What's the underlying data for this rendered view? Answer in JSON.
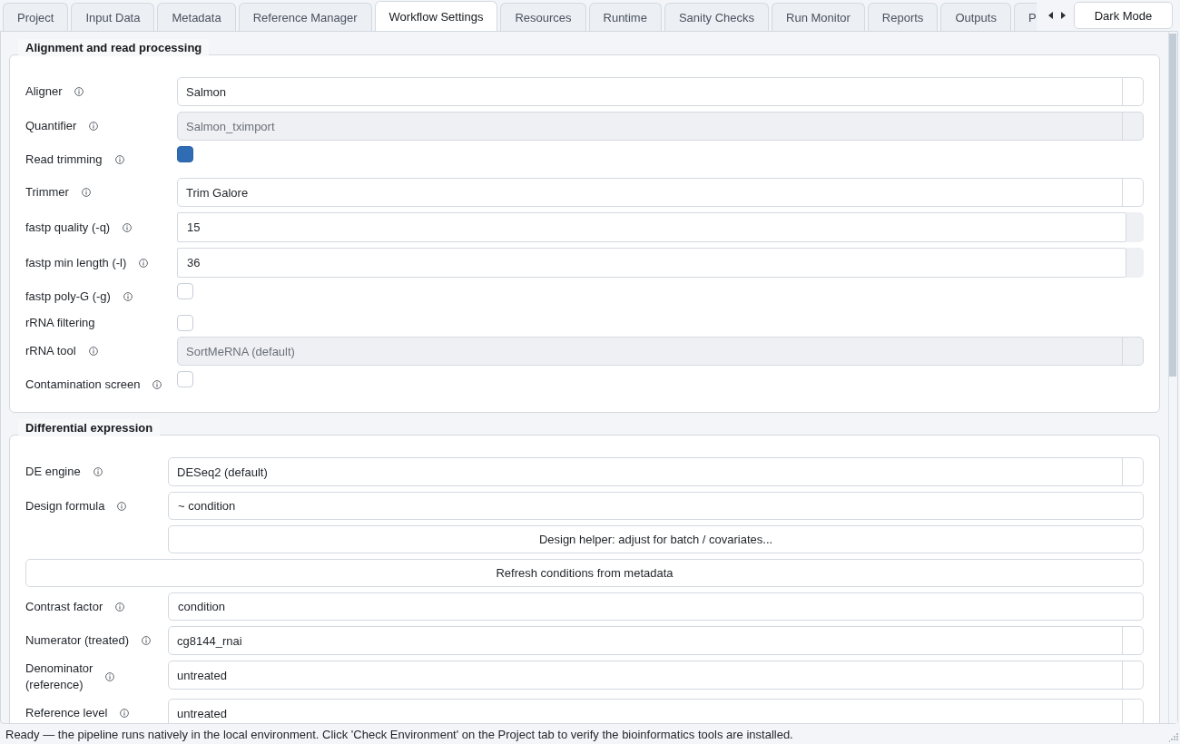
{
  "tabs": [
    {
      "label": "Project",
      "selected": false
    },
    {
      "label": "Input Data",
      "selected": false
    },
    {
      "label": "Metadata",
      "selected": false
    },
    {
      "label": "Reference Manager",
      "selected": false
    },
    {
      "label": "Workflow Settings",
      "selected": true
    },
    {
      "label": "Resources",
      "selected": false
    },
    {
      "label": "Runtime",
      "selected": false
    },
    {
      "label": "Sanity Checks",
      "selected": false
    },
    {
      "label": "Run Monitor",
      "selected": false
    },
    {
      "label": "Reports",
      "selected": false
    },
    {
      "label": "Outputs",
      "selected": false
    },
    {
      "label": "P",
      "selected": false
    }
  ],
  "dark_mode_button": {
    "label": "Dark Mode"
  },
  "groups": [
    {
      "title": "Alignment and read processing",
      "rows": [
        {
          "kind": "combo",
          "label": "Aligner",
          "info": true,
          "value": "Salmon",
          "disabled": false
        },
        {
          "kind": "combo",
          "label": "Quantifier",
          "info": true,
          "value": "Salmon_tximport",
          "disabled": true
        },
        {
          "kind": "checkbox",
          "label": "Read trimming",
          "info": true,
          "checked": true,
          "disabled": false
        },
        {
          "kind": "combo",
          "label": "Trimmer",
          "info": true,
          "value": "Trim Galore",
          "disabled": false
        },
        {
          "kind": "spin",
          "label": "fastp quality (-q)",
          "info": true,
          "value": "15",
          "disabled": false
        },
        {
          "kind": "spin",
          "label": "fastp min length (-l)",
          "info": true,
          "value": "36",
          "disabled": false
        },
        {
          "kind": "checkbox",
          "label": "fastp poly-G (-g)",
          "info": true,
          "checked": false,
          "disabled": false
        },
        {
          "kind": "checkbox",
          "label": "rRNA filtering",
          "info": false,
          "checked": false,
          "disabled": false
        },
        {
          "kind": "combo",
          "label": "rRNA tool",
          "info": true,
          "value": "SortMeRNA (default)",
          "disabled": true
        },
        {
          "kind": "checkbox",
          "label": "Contamination screen",
          "info": true,
          "checked": false,
          "disabled": false
        }
      ]
    },
    {
      "title": "Differential expression",
      "rows": [
        {
          "kind": "combo",
          "label": "DE engine",
          "info": true,
          "value": "DESeq2 (default)",
          "disabled": false
        },
        {
          "kind": "text",
          "label": "Design formula",
          "info": true,
          "value": "~ condition",
          "disabled": false
        },
        {
          "kind": "button",
          "label": "Design helper: adjust for batch / covariates...",
          "disabled": false
        },
        {
          "kind": "widebutton",
          "label": "Refresh conditions from metadata",
          "disabled": false
        },
        {
          "kind": "text",
          "label": "Contrast factor",
          "info": true,
          "value": "condition",
          "disabled": false
        },
        {
          "kind": "combo",
          "label": "Numerator (treated)",
          "info": true,
          "value": "cg8144_rnai",
          "disabled": false
        },
        {
          "kind": "combo",
          "label": "Denominator (reference)",
          "info": true,
          "value": "untreated",
          "disabled": false
        },
        {
          "kind": "combo",
          "label": "Reference level",
          "info": true,
          "value": "untreated",
          "disabled": false
        }
      ]
    }
  ],
  "status_bar": {
    "text": "Ready — the pipeline runs natively in the local environment. Click 'Check Environment' on the Project tab to verify the bioinformatics tools are installed."
  }
}
